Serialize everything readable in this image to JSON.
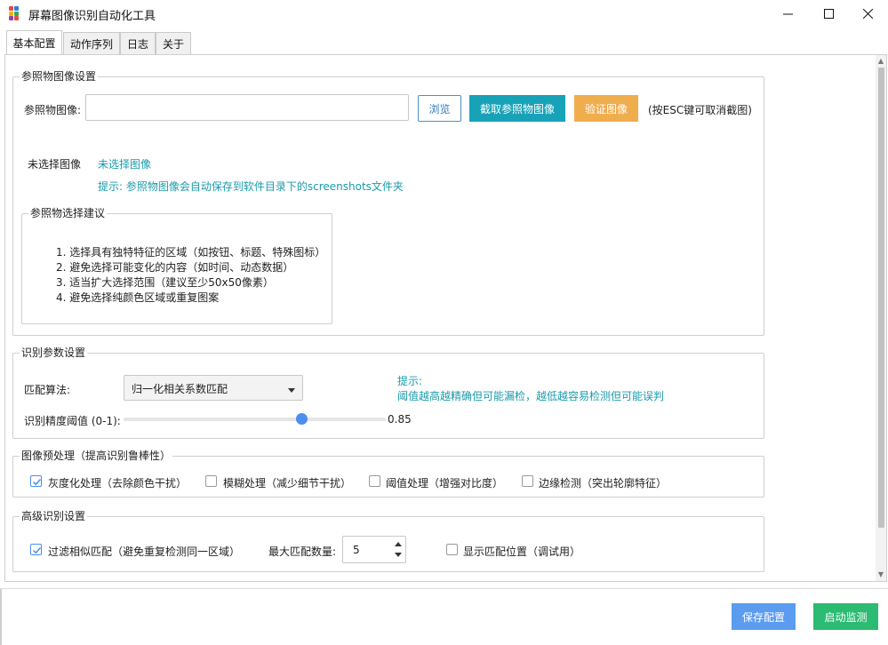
{
  "window": {
    "title": "屏幕图像识别自动化工具",
    "icon": "app-grid-icon",
    "controls": [
      "minimize-icon",
      "maximize-icon",
      "close-icon"
    ]
  },
  "tabs": [
    {
      "label": "基本配置",
      "active": true
    },
    {
      "label": "动作序列",
      "active": false
    },
    {
      "label": "日志",
      "active": false
    },
    {
      "label": "关于",
      "active": false
    }
  ],
  "reference_group": {
    "title": "参照物图像设置",
    "image_label": "参照物图像:",
    "image_value": "",
    "browse_label": "浏览",
    "capture_label": "截取参照物图像",
    "verify_label": "验证图像",
    "esc_hint": "(按ESC键可取消截图)",
    "preview_label": "未选择图像",
    "preview_status": "未选择图像",
    "save_hint": "提示: 参照物图像会自动保存到软件目录下的screenshots文件夹",
    "advice": {
      "title": "参照物选择建议",
      "items": [
        "1. 选择具有独特特征的区域（如按钮、标题、特殊图标）",
        "2. 避免选择可能变化的内容（如时间、动态数据）",
        "3. 适当扩大选择范围（建议至少50x50像素）",
        "4. 避免选择纯颜色区域或重复图案"
      ]
    }
  },
  "recognition_group": {
    "title": "识别参数设置",
    "algorithm_label": "匹配算法:",
    "algorithm_value": "归一化相关系数匹配",
    "threshold_label": "识别精度阈值 (0-1):",
    "threshold_value": "0.85",
    "threshold_fraction": 0.85,
    "tip_title": "提示:",
    "tip_text": "阈值越高越精确但可能漏检，越低越容易检测但可能误判"
  },
  "preprocess_group": {
    "title": "图像预处理（提高识别鲁棒性）",
    "options": [
      {
        "label": "灰度化处理（去除颜色干扰）",
        "checked": true
      },
      {
        "label": "模糊处理（减少细节干扰）",
        "checked": false
      },
      {
        "label": "阈值处理（增强对比度）",
        "checked": false
      },
      {
        "label": "边缘检测（突出轮廓特征）",
        "checked": false
      }
    ]
  },
  "advanced_group": {
    "title": "高级识别设置",
    "filter_label": "过滤相似匹配（避免重复检测同一区域）",
    "filter_checked": true,
    "max_matches_label": "最大匹配数量:",
    "max_matches_value": "5",
    "show_positions_label": "显示匹配位置（调试用）",
    "show_positions_checked": false
  },
  "footer": {
    "save_label": "保存配置",
    "start_label": "启动监测"
  },
  "colors": {
    "teal": "#17a2b8",
    "orange": "#f0ad4e",
    "blue": "#5b9cf0",
    "green": "#2bbb72",
    "accent": "#4a8ef0"
  }
}
